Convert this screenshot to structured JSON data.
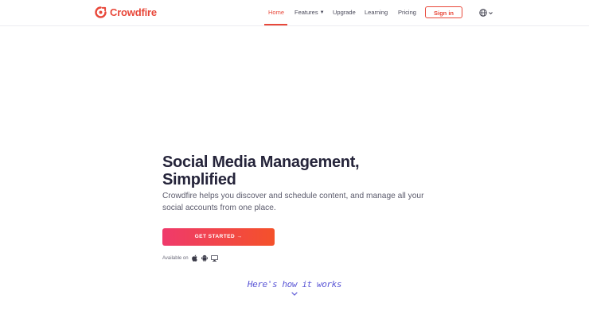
{
  "brand": {
    "name": "Crowdfire",
    "color": "#e8483a",
    "logo_icon": "crowdfire-logo-icon"
  },
  "nav": {
    "items": [
      {
        "label": "Home",
        "active": true
      },
      {
        "label": "Features",
        "has_dropdown": true
      },
      {
        "label": "Upgrade"
      },
      {
        "label": "Learning"
      },
      {
        "label": "Pricing"
      }
    ],
    "signin_label": "Sign in",
    "language_icon": "globe-icon"
  },
  "hero": {
    "title_line1": "Social Media Management,",
    "title_line2": "Simplified",
    "subtitle_line1": "Crowdfire helps you discover and schedule content, and manage all your",
    "subtitle_line2": "social accounts from one place.",
    "cta_label": "GET STARTED →",
    "cta_gradient": [
      "#ef3a6b",
      "#f4512a"
    ],
    "available_label": "Available on",
    "platforms": [
      "apple-icon",
      "android-icon",
      "desktop-icon"
    ]
  },
  "how_it_works": {
    "label": "Here's how it works",
    "color": "#5b57d6"
  }
}
